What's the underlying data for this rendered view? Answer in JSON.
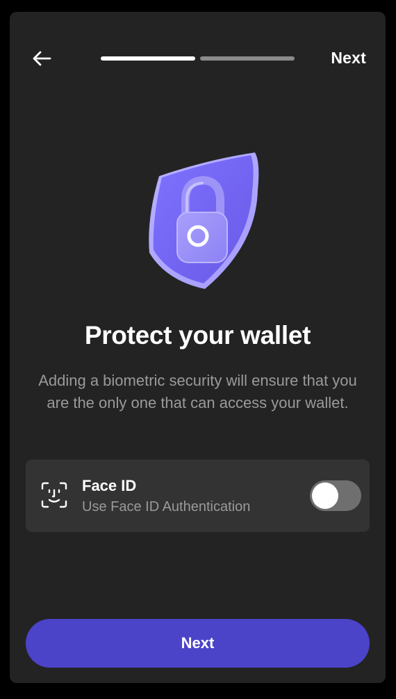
{
  "header": {
    "back_icon": "arrow-left-icon",
    "next_label": "Next",
    "progress": {
      "current_step": 1,
      "total_steps": 2
    }
  },
  "hero": {
    "icon": "shield-lock-icon",
    "accent_color": "#7c6cf2"
  },
  "main": {
    "title": "Protect your wallet",
    "description": "Adding a biometric security will ensure that you are the only one that can access your wallet."
  },
  "biometric_option": {
    "icon": "face-id-icon",
    "title": "Face ID",
    "subtitle": "Use Face ID Authentication",
    "enabled": false
  },
  "footer": {
    "primary_label": "Next",
    "primary_color": "#4b43c8"
  }
}
